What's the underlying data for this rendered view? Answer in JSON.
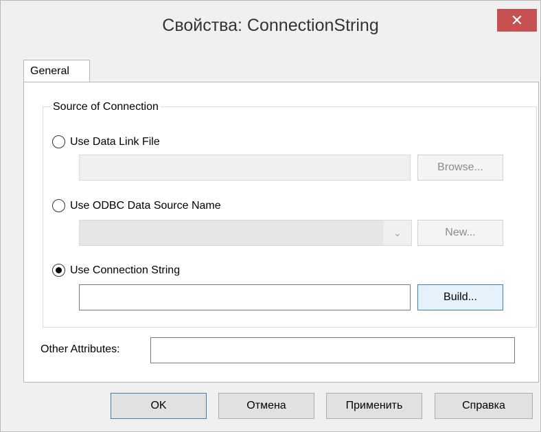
{
  "window": {
    "title": "Свойства: ConnectionString",
    "close_glyph": "✕"
  },
  "tabs": [
    {
      "label": "General",
      "selected": true
    }
  ],
  "source_group": {
    "label": "Source of Connection",
    "selected_option": "connection_string",
    "data_link": {
      "label": "Use Data Link File",
      "value": "",
      "button_label": "Browse...",
      "enabled": false
    },
    "odbc": {
      "label": "Use ODBC Data Source Name",
      "value": "",
      "button_label": "New...",
      "enabled": false
    },
    "conn_string": {
      "label": "Use Connection String",
      "value": "",
      "button_label": "Build...",
      "enabled": true
    }
  },
  "other_attributes": {
    "label": "Other Attributes:",
    "value": ""
  },
  "footer": {
    "ok_label": "OK",
    "cancel_label": "Отмена",
    "apply_label": "Применить",
    "help_label": "Справка"
  },
  "colors": {
    "close_button": "#c75050",
    "focus_border": "#3c7fb1"
  },
  "icons": {
    "close": "close-icon",
    "combo_arrow": "chevron-down-icon"
  }
}
